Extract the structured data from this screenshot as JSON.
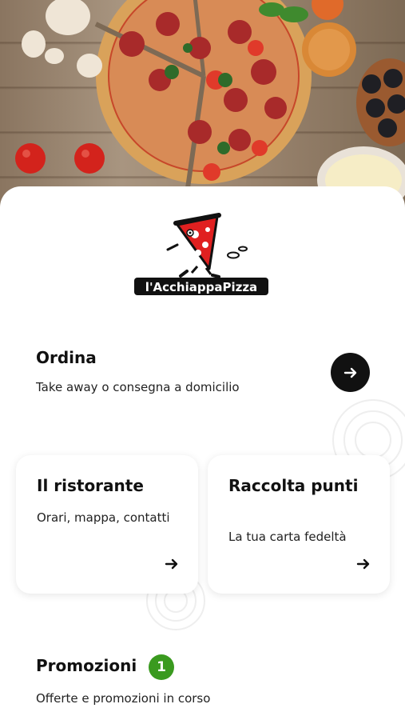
{
  "brand": {
    "logo_text": "l'AcchiappaPizza",
    "accent_color": "#e02020"
  },
  "order": {
    "title": "Ordina",
    "subtitle": "Take away o consegna a domicilio",
    "button_icon": "arrow-right-icon"
  },
  "cards": [
    {
      "title": "Il ristorante",
      "subtitle": "Orari, mappa, contatti",
      "icon": "arrow-right-icon"
    },
    {
      "title": "Raccolta punti",
      "subtitle": "La tua carta fedeltà",
      "icon": "arrow-right-icon"
    }
  ],
  "promotions": {
    "title": "Promozioni",
    "badge_count": "1",
    "badge_color": "#3a9a1f",
    "subtitle": "Offerte e promozioni in corso"
  }
}
